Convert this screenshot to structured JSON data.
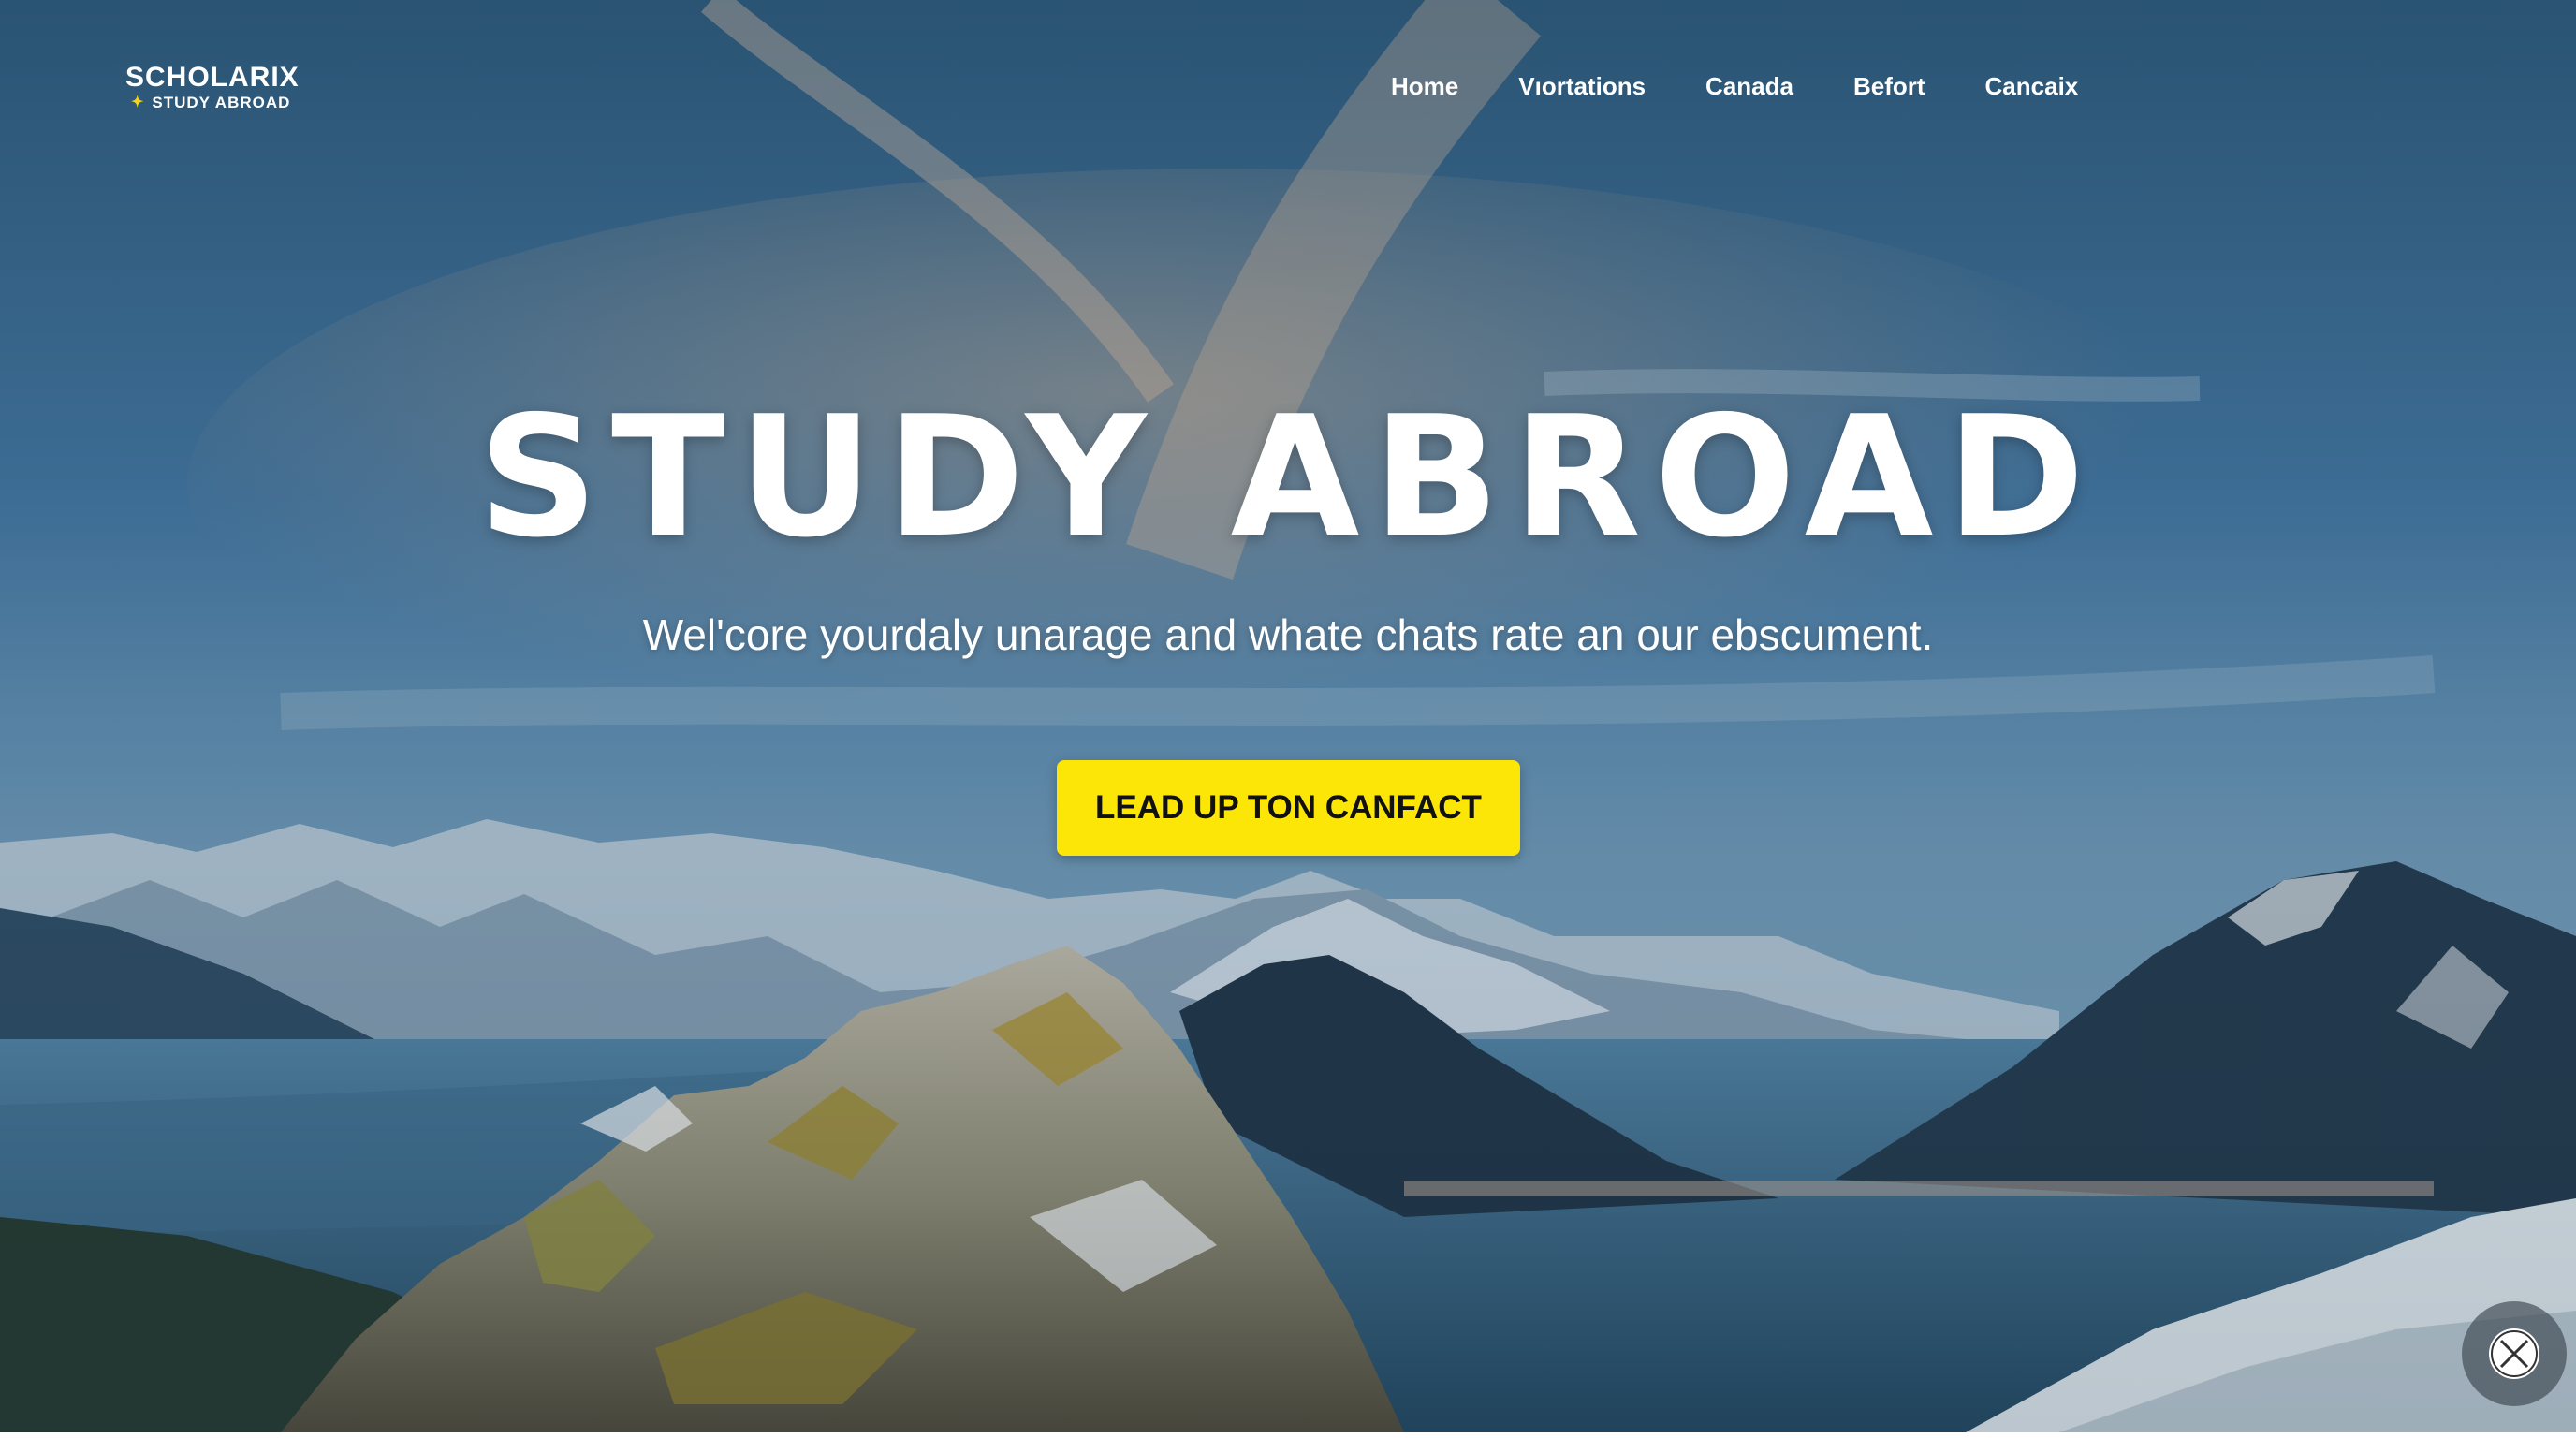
{
  "brand": {
    "name": "SCHOLARIX",
    "tagline": "STUDY ABROAD",
    "accent_color": "#f5d21c"
  },
  "nav": {
    "items": [
      {
        "label": "Home"
      },
      {
        "label": "Vıortations"
      },
      {
        "label": "Canada"
      },
      {
        "label": "Befort"
      },
      {
        "label": "Cancaix"
      }
    ]
  },
  "hero": {
    "title": "STUDY ABROAD",
    "subtitle": "Wel'core yourdaly unarage and whate chats rate an our ebscument.",
    "cta_label": "LEAD UP TON CANFACT",
    "cta_color": "#fbe607",
    "background_image": "mountain-lake-landscape"
  },
  "overlay": {
    "close_icon": "close-icon"
  }
}
